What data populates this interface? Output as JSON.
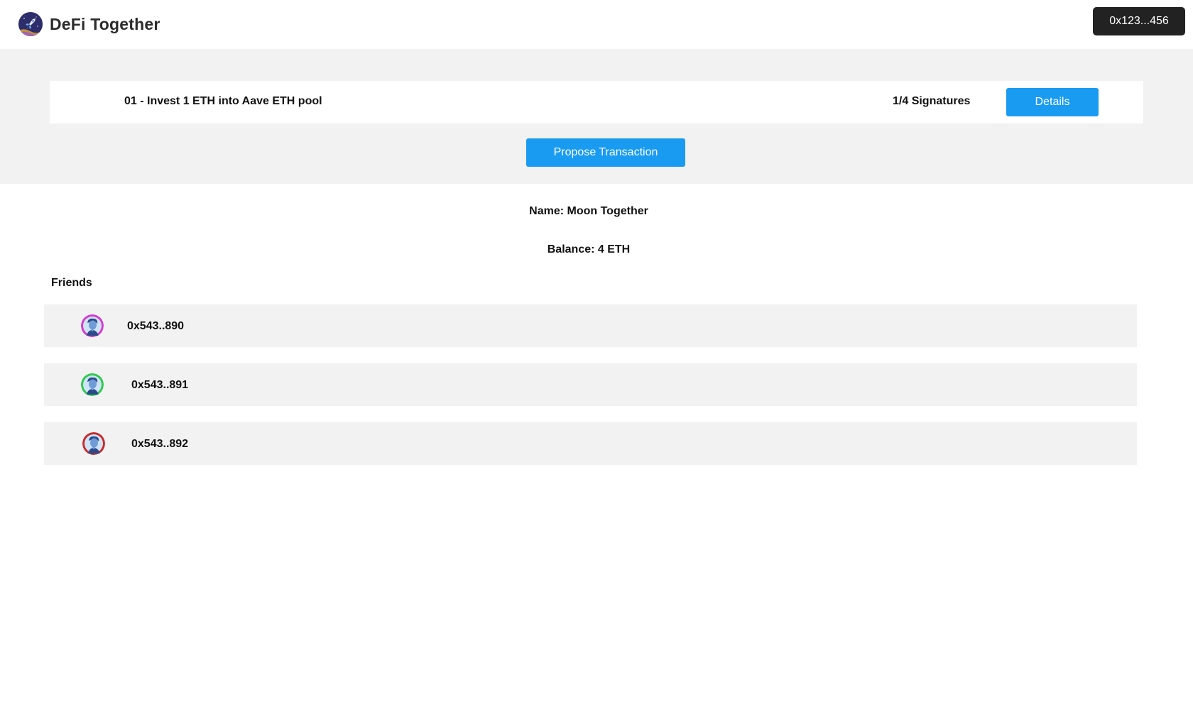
{
  "app": {
    "title": "DeFi Together",
    "logo_icon": "rocket-logo-icon"
  },
  "header": {
    "wallet_address": "0x123...456"
  },
  "proposals": [
    {
      "title": "01 - Invest 1 ETH into Aave ETH pool",
      "signatures": "1/4 Signatures",
      "details_label": "Details"
    }
  ],
  "propose_label": "Propose Transaction",
  "group": {
    "name": "Name: Moon Together",
    "balance": "Balance: 4 ETH"
  },
  "friends": {
    "heading": "Friends",
    "items": [
      {
        "address": "0x543..890",
        "avatar_icon": "avatar-icon",
        "ring_color": "#d63ad0"
      },
      {
        "address": "0x543..891",
        "avatar_icon": "avatar-icon",
        "ring_color": "#2ec94a"
      },
      {
        "address": "0x543..892",
        "avatar_icon": "avatar-icon",
        "ring_color": "#c92a2a"
      }
    ]
  },
  "colors": {
    "primary_button": "#1a9bf2",
    "wallet_button": "#222222",
    "band_background": "#f2f2f2"
  }
}
